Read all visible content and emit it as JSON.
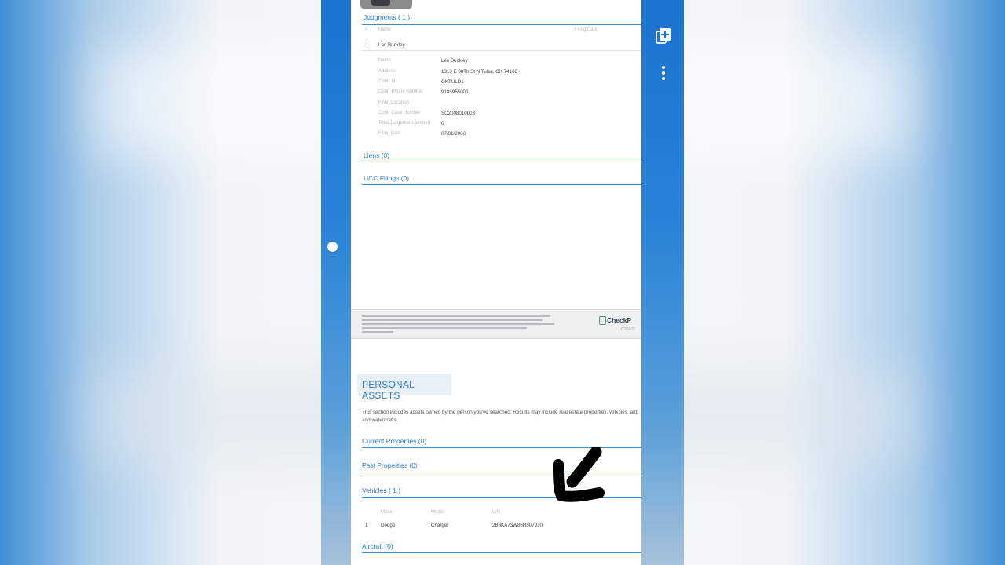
{
  "report": {
    "judgments": {
      "title": "Judgments ( 1 )",
      "columns": [
        "#",
        "Name",
        "Filing Date"
      ],
      "rows": [
        {
          "index": "1",
          "name": "Leo Buckley"
        }
      ],
      "details": [
        {
          "label": "Name",
          "value": "Leo Buckley"
        },
        {
          "label": "Address",
          "value": "1313 E 38Th St N Tulsa, OK 74106"
        },
        {
          "label": "Court Id",
          "value": "OKTULD1"
        },
        {
          "label": "Court Phone Number",
          "value": "9185965000"
        },
        {
          "label": "Filing Location",
          "value": ""
        },
        {
          "label": "Court Case Number",
          "value": "SC2008010003"
        },
        {
          "label": "Total Judgement Amount",
          "value": "0"
        },
        {
          "label": "Filing Date",
          "value": "07/01/2008"
        }
      ]
    },
    "liens_title": "Liens (0)",
    "ucc_title": "UCC Filings (0)",
    "footer": {
      "brand": "CheckP",
      "code": "C2NFK"
    },
    "personal_assets": {
      "heading": "PERSONAL ASSETS",
      "description": "This section includes assets owned by the person you've searched. Results may include real estate properties, vehicles, airp and watercrafts.",
      "current_properties": "Current Properties (0)",
      "past_properties": "Past Properties (0)",
      "vehicles": {
        "title": "Vehicles ( 1 )",
        "columns": [
          "Make",
          "Model",
          "VIN"
        ],
        "rows": [
          {
            "index": "1",
            "make": "Dodge",
            "model": "Charger",
            "vin": "2B3KA73W86H507930"
          }
        ]
      },
      "aircraft": "Aircraft (0)"
    }
  },
  "icons": {
    "add_page": "add-page-icon",
    "more": "more-vertical-icon",
    "annotation": "hand-drawn-arrow-icon"
  },
  "colors": {
    "accent": "#2d7ac6",
    "device_blue": "#1a74d0"
  }
}
